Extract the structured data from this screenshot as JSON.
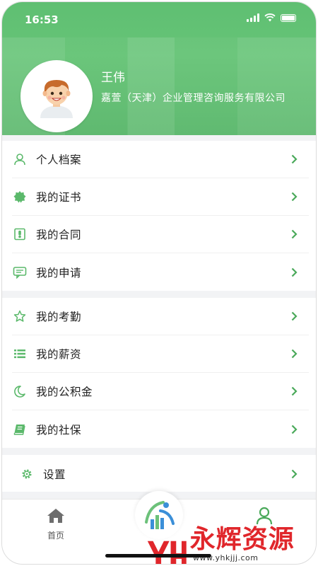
{
  "status_bar": {
    "time": "16:53"
  },
  "profile": {
    "name": "王伟",
    "company": "嘉萱（天津）企业管理咨询服务有限公司"
  },
  "menu_group_1": [
    {
      "label": "个人档案",
      "icon": "person-icon"
    },
    {
      "label": "我的证书",
      "icon": "certificate-icon"
    },
    {
      "label": "我的合同",
      "icon": "contract-icon"
    },
    {
      "label": "我的申请",
      "icon": "application-icon"
    }
  ],
  "menu_group_2": [
    {
      "label": "我的考勤",
      "icon": "star-icon"
    },
    {
      "label": "我的薪资",
      "icon": "list-icon"
    },
    {
      "label": "我的公积金",
      "icon": "moon-icon"
    },
    {
      "label": "我的社保",
      "icon": "book-icon"
    }
  ],
  "menu_group_3": [
    {
      "label": "设置",
      "icon": "gear-icon"
    }
  ],
  "tabbar": {
    "home_label": "首页"
  },
  "watermark": {
    "text": "永辉资源网",
    "url": "www.yhkjjj.com"
  },
  "colors": {
    "accent": "#5bb96b",
    "header_bg": "#62c174",
    "watermark_red": "#e0262b"
  }
}
